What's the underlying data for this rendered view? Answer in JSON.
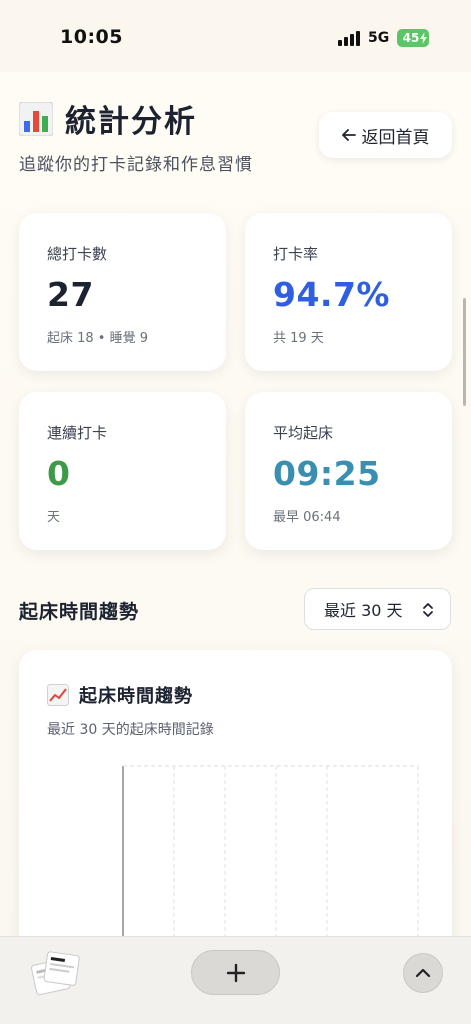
{
  "status_bar": {
    "time": "10:05",
    "network": "5G",
    "battery": "45"
  },
  "header": {
    "title": "統計分析",
    "subtitle": "追蹤你的打卡記錄和作息習慣",
    "back_label": "返回首頁"
  },
  "stats": [
    {
      "label": "總打卡數",
      "value": "27",
      "sub": "起床 18 • 睡覺 9",
      "color": "#1c2230"
    },
    {
      "label": "打卡率",
      "value": "94.7%",
      "sub": "共 19 天",
      "color": "#2f5fe0"
    },
    {
      "label": "連續打卡",
      "value": "0",
      "sub": "天",
      "color": "#3e9a48"
    },
    {
      "label": "平均起床",
      "value": "09:25",
      "sub": "最早 06:44",
      "color": "#3a8fb0"
    }
  ],
  "trend_section": {
    "title": "起床時間趨勢",
    "range_selected": "最近 30 天"
  },
  "chart_card": {
    "title": "起床時間趨勢",
    "subtitle": "最近 30 天的起床時間記錄"
  },
  "colors": {
    "accent_blue": "#2f5fe0",
    "accent_green": "#3e9a48",
    "accent_teal": "#3a8fb0",
    "battery_green": "#5cc567"
  }
}
